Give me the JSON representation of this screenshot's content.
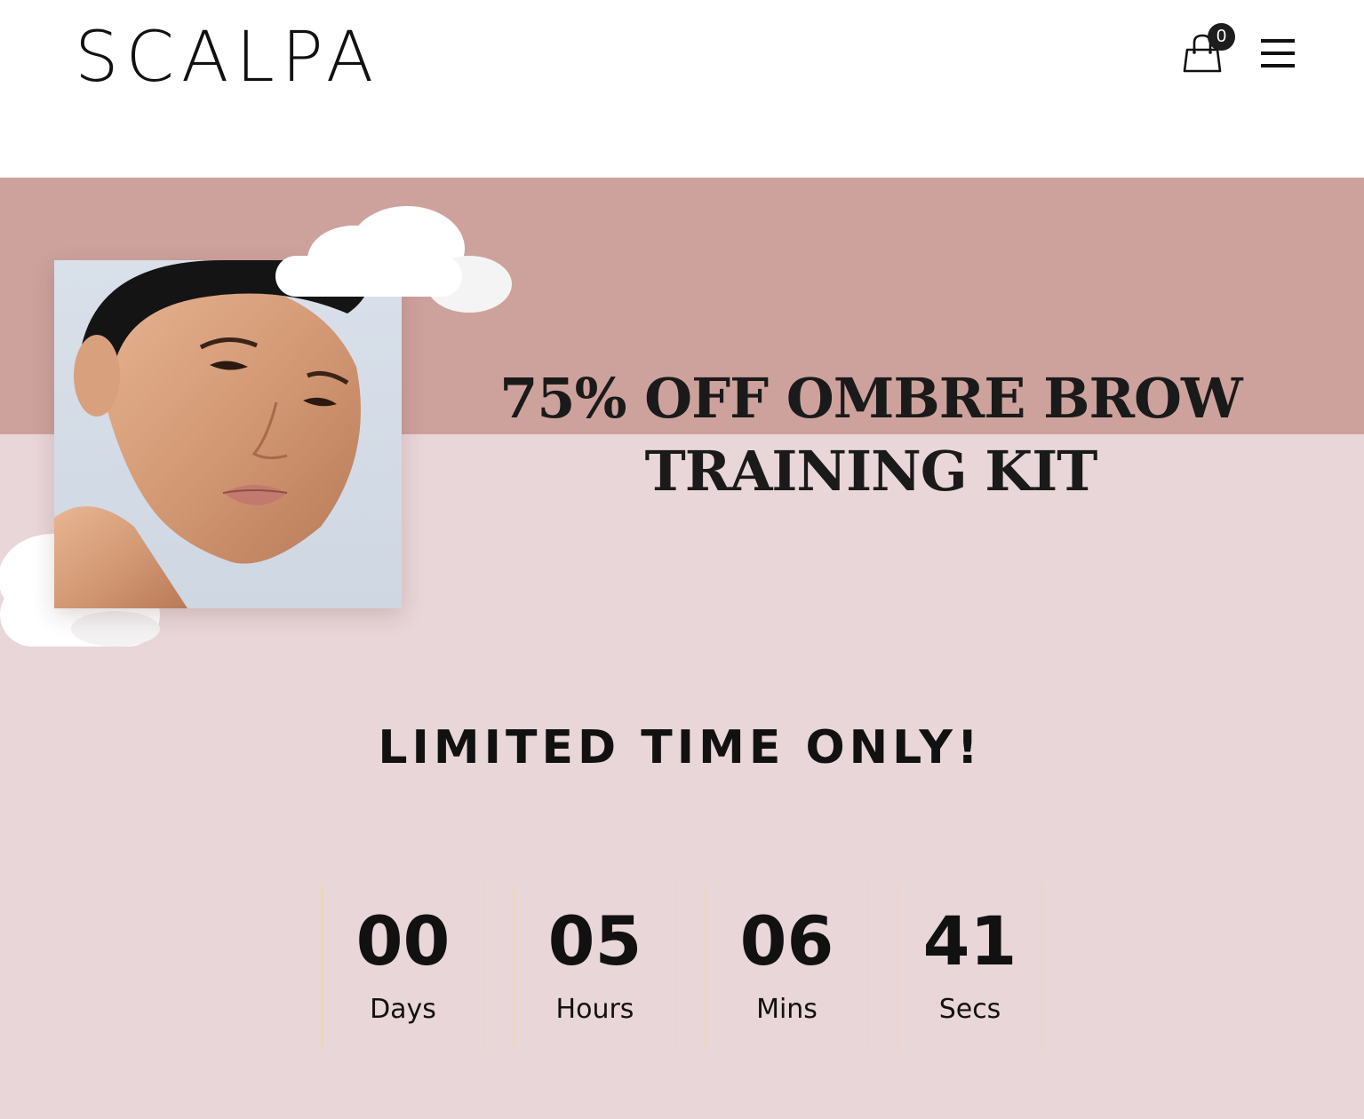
{
  "brand": {
    "name": "SCALPA"
  },
  "header": {
    "cart_icon": "shopping-bag-icon",
    "cart_count": "0",
    "menu_icon": "hamburger-menu-icon"
  },
  "hero": {
    "headline_line1": "75% OFF OMBRE BROW",
    "headline_line2": "TRAINING KIT",
    "colors": {
      "top_band": "#cea29c",
      "bottom_band": "#e9d6d8"
    }
  },
  "promo": {
    "limited_text": "LIMITED TIME ONLY!"
  },
  "countdown": [
    {
      "value": "00",
      "label": "Days"
    },
    {
      "value": "05",
      "label": "Hours"
    },
    {
      "value": "06",
      "label": "Mins"
    },
    {
      "value": "41",
      "label": "Secs"
    }
  ]
}
